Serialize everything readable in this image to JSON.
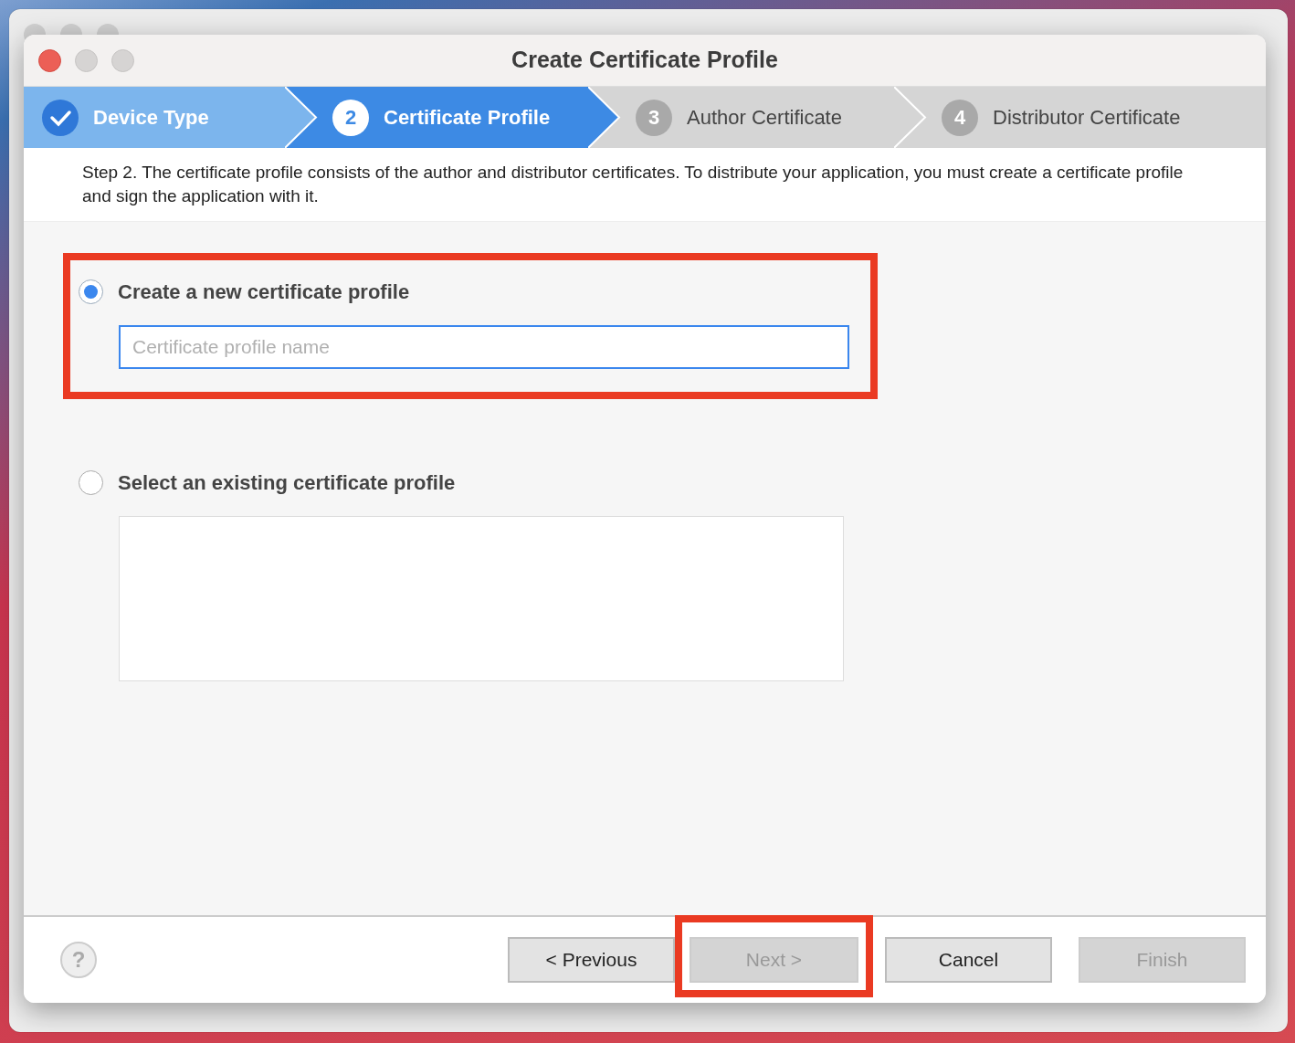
{
  "window": {
    "title": "Create Certificate Profile"
  },
  "steps": [
    {
      "label": "Device Type",
      "done": true,
      "current": false
    },
    {
      "number": "2",
      "label": "Certificate Profile",
      "done": false,
      "current": true
    },
    {
      "number": "3",
      "label": "Author Certificate",
      "done": false,
      "current": false
    },
    {
      "number": "4",
      "label": "Distributor Certificate",
      "done": false,
      "current": false
    }
  ],
  "description": "Step 2. The certificate profile consists of the author and distributor certificates. To distribute your application, you must create a certificate profile and sign the application with it.",
  "options": [
    {
      "kind": "field",
      "label": "Create a new certificate profile",
      "selected": true,
      "highlighted": true,
      "placeholder": "Certificate profile name"
    },
    {
      "kind": "list",
      "label": "Select an existing certificate profile",
      "selected": false,
      "highlighted": false
    }
  ],
  "help": "?",
  "buttons": [
    {
      "label": "< Previous",
      "disabled": false,
      "highlighted": false
    },
    {
      "label": "Next >",
      "disabled": true,
      "highlighted": true
    },
    {
      "label": "Cancel",
      "disabled": false,
      "highlighted": false
    },
    {
      "label": "Finish",
      "disabled": true,
      "highlighted": false
    }
  ]
}
